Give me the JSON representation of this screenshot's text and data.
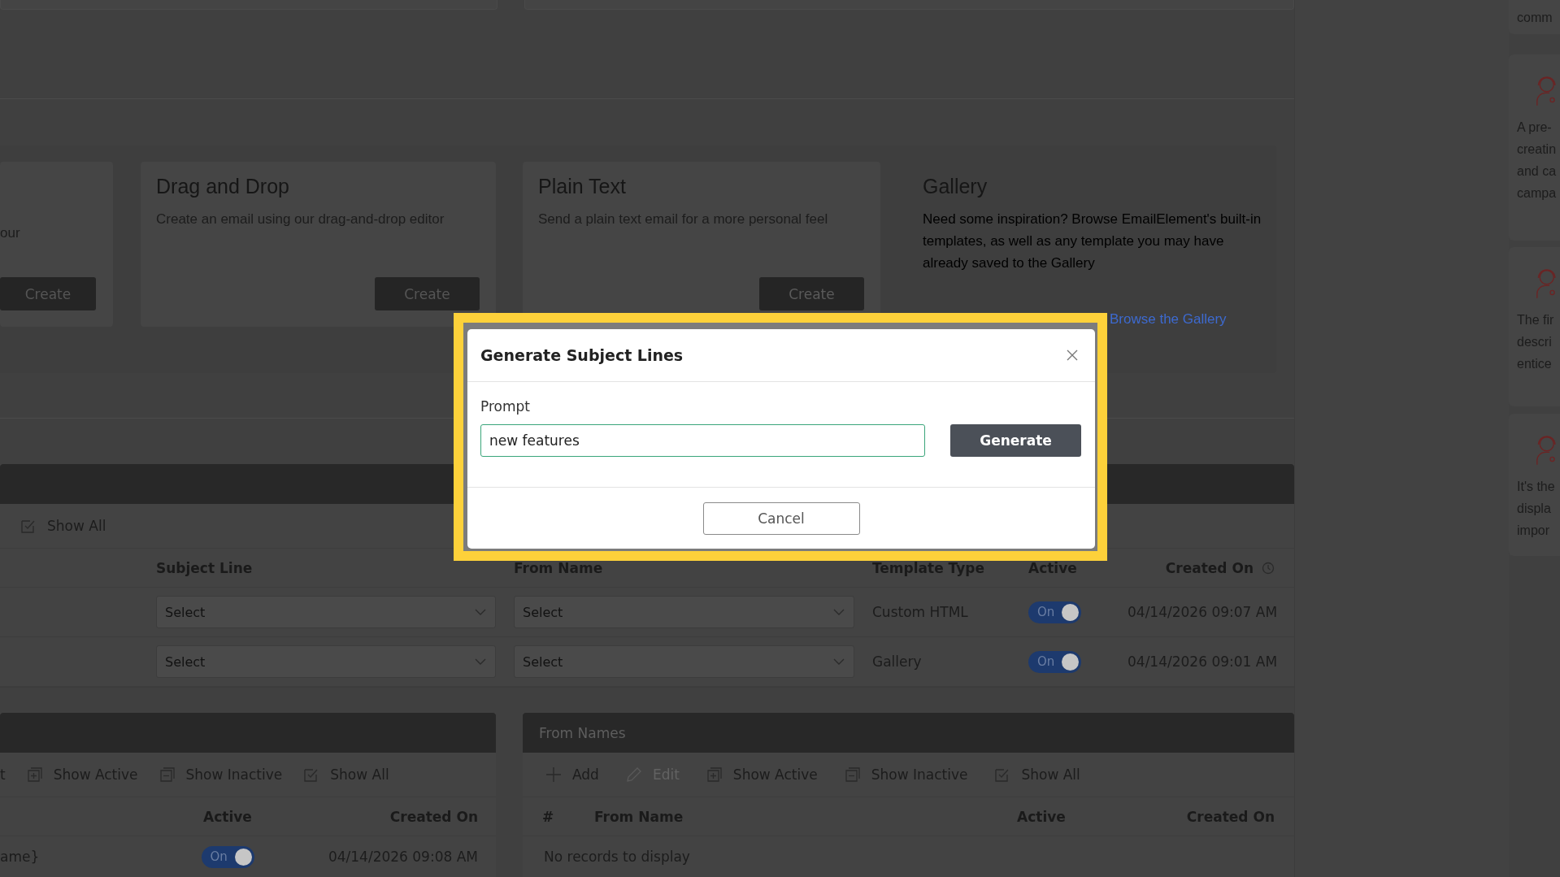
{
  "templates": [
    {
      "description": "our",
      "button": "Create"
    },
    {
      "title": "Drag and Drop",
      "description": "Create an email using our drag-and-drop editor",
      "button": "Create"
    },
    {
      "title": "Plain Text",
      "description": "Send a plain text email for a more personal feel",
      "button": "Create"
    }
  ],
  "gallery": {
    "title": "Gallery",
    "description": "Need some inspiration? Browse EmailElement's built-in templates, as well as any template you may have already saved to the Gallery",
    "link": "Browse the Gallery"
  },
  "campaign_table": {
    "toolbar": [
      {
        "kind": "show_all",
        "label": "Show All",
        "disabled": false
      }
    ],
    "columns": [
      "Subject Line",
      "From Name",
      "Template Type",
      "Active",
      "Created On"
    ],
    "rows": [
      {
        "subject_line": "Select",
        "from_name": "Select",
        "template_type": "Custom HTML",
        "active": true,
        "active_label": "On",
        "created_on": "04/14/2026 09:07 AM"
      },
      {
        "subject_line": "Select",
        "from_name": "Select",
        "template_type": "Gallery",
        "active": true,
        "active_label": "On",
        "created_on": "04/14/2026 09:01 AM"
      }
    ]
  },
  "subject_panel": {
    "toolbar": [
      {
        "kind": "text",
        "label": "t",
        "disabled": false
      },
      {
        "kind": "show_active",
        "label": "Show Active",
        "disabled": false
      },
      {
        "kind": "show_inactive",
        "label": "Show Inactive",
        "disabled": false
      },
      {
        "kind": "show_all",
        "label": "Show All",
        "disabled": false
      }
    ],
    "columns": [
      "Active",
      "Created On"
    ],
    "rows": [
      {
        "name": "ame}",
        "active": true,
        "active_label": "On",
        "created_on": "04/14/2026 09:08 AM"
      }
    ]
  },
  "from_names_panel": {
    "title": "From Names",
    "toolbar": [
      {
        "kind": "add",
        "label": "Add",
        "disabled": false
      },
      {
        "kind": "edit",
        "label": "Edit",
        "disabled": true
      },
      {
        "kind": "show_active",
        "label": "Show Active",
        "disabled": false
      },
      {
        "kind": "show_inactive",
        "label": "Show Inactive",
        "disabled": false
      },
      {
        "kind": "show_all",
        "label": "Show All",
        "disabled": false
      }
    ],
    "columns": [
      "#",
      "From Name",
      "Active",
      "Created On"
    ],
    "empty_message": "No records to display"
  },
  "tips": [
    {
      "icon": false,
      "lines": [
        "comm"
      ]
    },
    {
      "icon": true,
      "lines": [
        "A pre-",
        "creatin",
        "and ca",
        "campa"
      ]
    },
    {
      "icon": true,
      "lines": [
        "The fir",
        "descri",
        "entice"
      ]
    },
    {
      "icon": true,
      "lines": [
        "It's the",
        "displa",
        "impor"
      ]
    }
  ],
  "modal": {
    "title": "Generate Subject Lines",
    "prompt_label": "Prompt",
    "prompt_value": "new features",
    "generate": "Generate",
    "cancel": "Cancel"
  }
}
